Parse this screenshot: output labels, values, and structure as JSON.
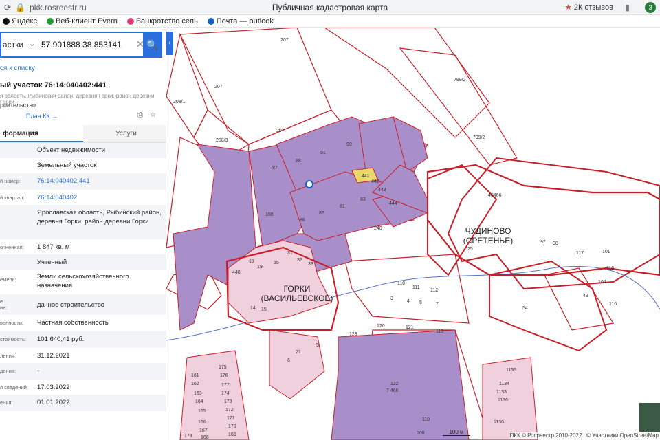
{
  "browser": {
    "url": "pkk.rosreestr.ru",
    "page_title": "Публичная кадастровая карта",
    "reviews": "2К отзывов",
    "bookmarks": [
      "Яндекс",
      "Веб-клиент Evern",
      "Банкротство сель",
      "Почта — outlook"
    ]
  },
  "search": {
    "type": "астки",
    "value": "57.901888 38.853141"
  },
  "panel": {
    "back": "ся к списку",
    "title": "ый участок 76:14:040402:441",
    "address": "я область, Рыбинский район, деревня Горки, район деревни Горки",
    "usage": "роительство",
    "plan": "План КК →",
    "tabs": [
      "формация",
      "Услуги"
    ],
    "rows": [
      {
        "k": "",
        "v": "Объект недвижимости"
      },
      {
        "k": "",
        "v": "Земельный участок"
      },
      {
        "k": "й номер:",
        "v": "76:14:040402:441",
        "link": true
      },
      {
        "k": "й квартал:",
        "v": "76:14:040402",
        "link": true
      },
      {
        "k": "",
        "v": "Ярославская область, Рыбинский район, деревня Горки, район деревни Горки"
      },
      {
        "k": "очненная:",
        "v": "1 847 кв. м"
      },
      {
        "k": "",
        "v": "Учтенный"
      },
      {
        "k": "емель:",
        "v": "Земли сельскохозяйственного назначения"
      },
      {
        "k": "е ие:",
        "v": "дачное строительство"
      },
      {
        "k": "венности:",
        "v": "Частная собственность"
      },
      {
        "k": "стоимость:",
        "v": "101 640,41 руб."
      },
      {
        "k": "ления:",
        "v": "31.12.2021"
      },
      {
        "k": "дения:",
        "v": "-"
      },
      {
        "k": "я сведений:",
        "v": "17.03.2022"
      },
      {
        "k": "ения:",
        "v": "01.01.2022"
      }
    ]
  },
  "map": {
    "labels": {
      "chudinovo": "ЧУДИНОВО",
      "sretenie": "(СРЕТЕНЬЕ)",
      "gorki": "ГОРКИ",
      "vasilevskoe": "(ВАСИЛЬЕВСКОЕ)"
    },
    "parcel_numbers": [
      "207",
      "207",
      "207",
      "208/1",
      "208/3",
      "799/2",
      "799/2",
      "87",
      "88",
      "91",
      "90",
      "108",
      "86",
      "82",
      "81",
      "83",
      "441",
      "442",
      "443",
      "444",
      "240",
      "448",
      "40466",
      "54",
      "116",
      "110",
      "111",
      "112",
      "3",
      "4",
      "5",
      "7",
      "123",
      "120",
      "121",
      "119",
      "122",
      "7 466",
      "1135",
      "1134",
      "1133",
      "1136",
      "1130",
      "110",
      "108",
      "18",
      "19",
      "14",
      "15",
      "35",
      "25",
      "97",
      "98",
      "117",
      "116",
      "104",
      "43",
      "101",
      "31",
      "32",
      "33",
      "21",
      "6",
      "5",
      "161",
      "162",
      "163",
      "164",
      "165",
      "166",
      "167",
      "168",
      "175",
      "176",
      "177",
      "174",
      "173",
      "172",
      "171",
      "170",
      "169",
      "178"
    ],
    "scale": "100 м",
    "attribution": "ПКК © Росреестр 2010-2022 | © Участники OpenStreetMap"
  },
  "colors": {
    "parcel_purple": "#a98fc9",
    "selected": "#e8d86a",
    "boundary_red": "#c8202a",
    "pink": "#f0d0dc",
    "accent": "#2a6fdb"
  }
}
